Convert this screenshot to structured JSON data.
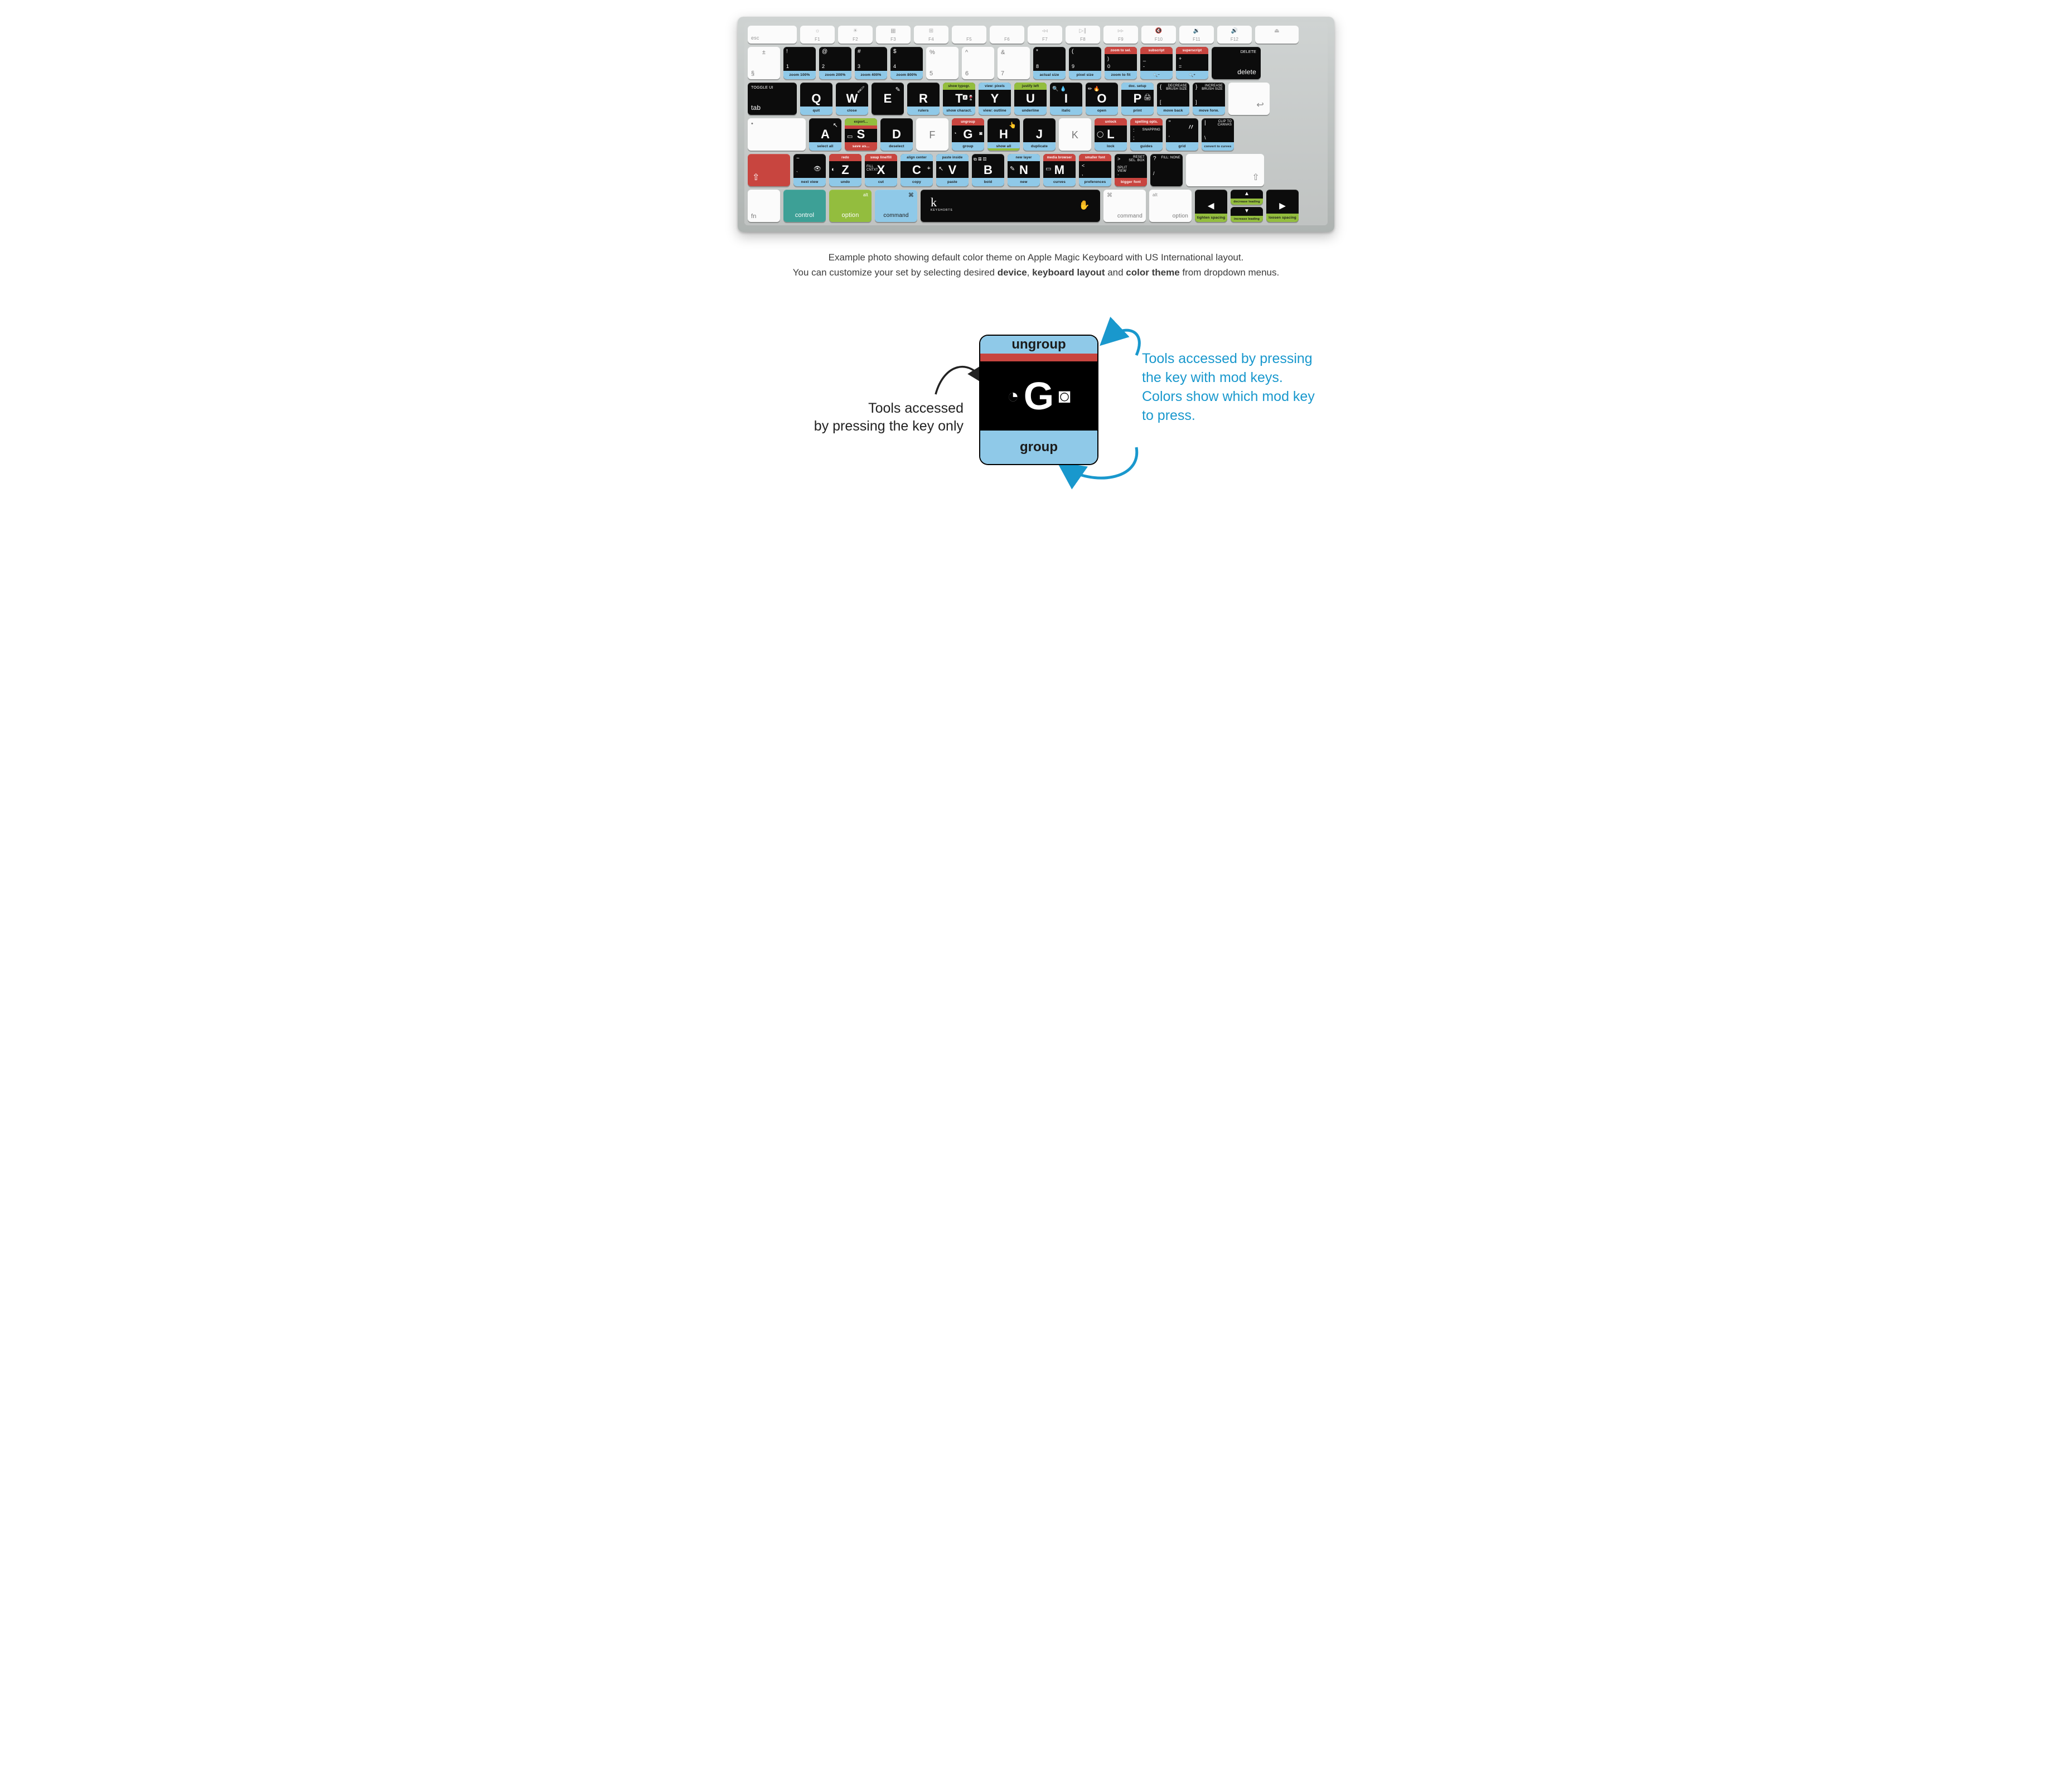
{
  "caption": {
    "line1_pre": "Example photo showing default color theme on Apple Magic Keyboard with US International layout.",
    "line2_pre": "You can customize your set by selecting desired ",
    "b1": "device",
    "sep1": ", ",
    "b2": "keyboard layout",
    "sep2": " and ",
    "b3": "color theme",
    "line2_post": " from dropdown menus."
  },
  "fnrow": {
    "esc": "esc",
    "f1": {
      "l": "F1",
      "s": "☼"
    },
    "f2": {
      "l": "F2",
      "s": "☀"
    },
    "f3": {
      "l": "F3",
      "s": "▦"
    },
    "f4": {
      "l": "F4",
      "s": "⊞"
    },
    "f5": {
      "l": "F5",
      "s": ""
    },
    "f6": {
      "l": "F6",
      "s": ""
    },
    "f7": {
      "l": "F7",
      "s": "◃◃"
    },
    "f8": {
      "l": "F8",
      "s": "▷∥"
    },
    "f9": {
      "l": "F9",
      "s": "▹▹"
    },
    "f10": {
      "l": "F10",
      "s": "🔇"
    },
    "f11": {
      "l": "F11",
      "s": "🔉"
    },
    "f12": {
      "l": "F12",
      "s": "🔊"
    },
    "eject": "⏏"
  },
  "r1": {
    "tilde_top": "±",
    "tilde_bot": "§",
    "k1": {
      "s": "!",
      "n": "1",
      "b": "zoom 100%"
    },
    "k2": {
      "s": "@",
      "n": "2",
      "b": "zoom 200%"
    },
    "k3": {
      "s": "#",
      "n": "3",
      "b": "zoom 400%"
    },
    "k4": {
      "s": "$",
      "n": "4",
      "b": "zoom 800%"
    },
    "k5": {
      "s": "%",
      "n": "5"
    },
    "k6": {
      "s": "^",
      "n": "6"
    },
    "k7": {
      "s": "&",
      "n": "7"
    },
    "k8": {
      "s": "*",
      "n": "8",
      "b": "actual size"
    },
    "k9": {
      "s": "(",
      "n": "9",
      "b": "pixel size"
    },
    "k0": {
      "s": ")",
      "n": "0",
      "t": "zoom to sel.",
      "b": "zoom to fit"
    },
    "kmin": {
      "s": "_",
      "n": "-",
      "t": "subscript",
      "ic": "🔍⁻"
    },
    "keq": {
      "s": "+",
      "n": "=",
      "t": "superscript",
      "ic": "🔍⁺"
    },
    "del_top": "DELETE",
    "del_bot": "delete"
  },
  "r2": {
    "tab_top": "TOGGLE UI",
    "tab_bot": "tab",
    "Q": {
      "b": "quit"
    },
    "W": {
      "b": "close",
      "ic": "🖌"
    },
    "E": {
      "b": "",
      "ic": "✎"
    },
    "R": {
      "b": "rulers"
    },
    "T": {
      "t": "show typogr.",
      "b": "show charact.",
      "ic": "🅰🍷"
    },
    "Y": {
      "t": "view: pixels",
      "b": "view: outline"
    },
    "U": {
      "b": "underline",
      "t": "justify left"
    },
    "I": {
      "b": "italic",
      "ic": "🔍 💧"
    },
    "O": {
      "b": "open",
      "ic": "✏ 🔥"
    },
    "P": {
      "t": "doc. setup",
      "b": "print",
      "ic": "🖨"
    },
    "lbr": {
      "s": "{",
      "n": "[",
      "t": "DECREASE BRUSH SIZE",
      "b": "move back"
    },
    "rbr": {
      "s": "}",
      "n": "]",
      "t": "INCREASE BRUSH SIZE",
      "b": "move forw."
    },
    "ret": "↩"
  },
  "r3": {
    "caps": "•",
    "A": {
      "b": "select all",
      "ic": "↖"
    },
    "S": {
      "t": "export...",
      "tr": "",
      "b": "save as...",
      "ic": "▭"
    },
    "D": {
      "b": "deselect"
    },
    "F": "F",
    "G": {
      "t": "ungroup",
      "b": "group",
      "ic": "◔ ◙"
    },
    "H": {
      "b": "show all",
      "ic": "👆"
    },
    "J": {
      "b": "duplicate"
    },
    "K": "K",
    "L": {
      "t": "unlock",
      "b": "lock",
      "ic": "◯"
    },
    "semi": {
      "s": ":",
      "n": ";",
      "t": "spelling opts.",
      "b": "guides",
      "lbl": "SNAPPING"
    },
    "quote": {
      "s": "\"",
      "n": "'",
      "b": "grid",
      "lbl": "〃"
    },
    "bsl": {
      "s": "|",
      "n": "\\",
      "lbl": "CLIP TO CANVAS",
      "b": "convert to curves"
    }
  },
  "r4": {
    "shift": "⇧",
    "grave": {
      "s": "~",
      "n": "`",
      "b": "next view",
      "ic": "👁"
    },
    "Z": {
      "t": "redo",
      "b": "undo",
      "ic": "◐"
    },
    "X": {
      "t": "swap line/fill",
      "b": "cut",
      "lbl": "FILL CNTXT"
    },
    "C": {
      "t": "align center",
      "b": "copy",
      "ic": "⌖"
    },
    "V": {
      "t": "paste inside",
      "b": "paste",
      "ic": "↖"
    },
    "B": {
      "b": "bold",
      "ic": "⧉ ▦ ▧"
    },
    "N": {
      "t": "new layer",
      "b": "new",
      "ic": "✎"
    },
    "M": {
      "t": "media browser",
      "b": "curves",
      "ic": "▭"
    },
    "comma": {
      "s": "<",
      "n": ",",
      "t": "smaller font",
      "b": "preferences"
    },
    "period": {
      "s": ">",
      "n": ".",
      "lbl": "SPLIT VIEW",
      "t": "",
      "b": "bigger font",
      "rlbl": "RESET SEL. BOX"
    },
    "slash": {
      "s": "?",
      "n": "/",
      "lbl": "FILL: NONE"
    }
  },
  "r5": {
    "fn": "fn",
    "control": "control",
    "option": "option",
    "opt_sub": "alt",
    "command": "command",
    "cmd_sym": "⌘",
    "space": "k",
    "space_sub": "KEYSHORTS",
    "space_ic": "✋",
    "left": {
      "b": "tighten spacing"
    },
    "up": {
      "b": "decrease leading"
    },
    "down": {
      "b": "increase leading"
    },
    "right": {
      "b": "loosen spacing"
    }
  },
  "diagram": {
    "ungroup": "ungroup",
    "group": "group",
    "left1": "Tools accessed",
    "left2": "by pressing the key only",
    "right": "Tools accessed by pressing the key with mod keys. Colors show which mod key to press."
  }
}
